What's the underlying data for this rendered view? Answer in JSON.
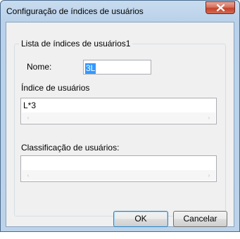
{
  "window": {
    "title": "Configuração de índices de usuários",
    "close_icon": "close-icon"
  },
  "group": {
    "legend": "Lista de índices de usuários1"
  },
  "name_field": {
    "label": "Nome:",
    "value": "3L"
  },
  "index_field": {
    "label": "Índice de usuários",
    "value": "L*3"
  },
  "classification_field": {
    "label": "Classificação de usuários:",
    "value": ""
  },
  "scroll_icons": {
    "left": "‹",
    "right": "›"
  },
  "buttons": {
    "ok": "OK",
    "cancel": "Cancelar"
  },
  "colors": {
    "title_bar": "#b9d1ea",
    "client_bg": "#f0f0f0",
    "close_button": "#c4432b",
    "selection": "#3399ff"
  }
}
